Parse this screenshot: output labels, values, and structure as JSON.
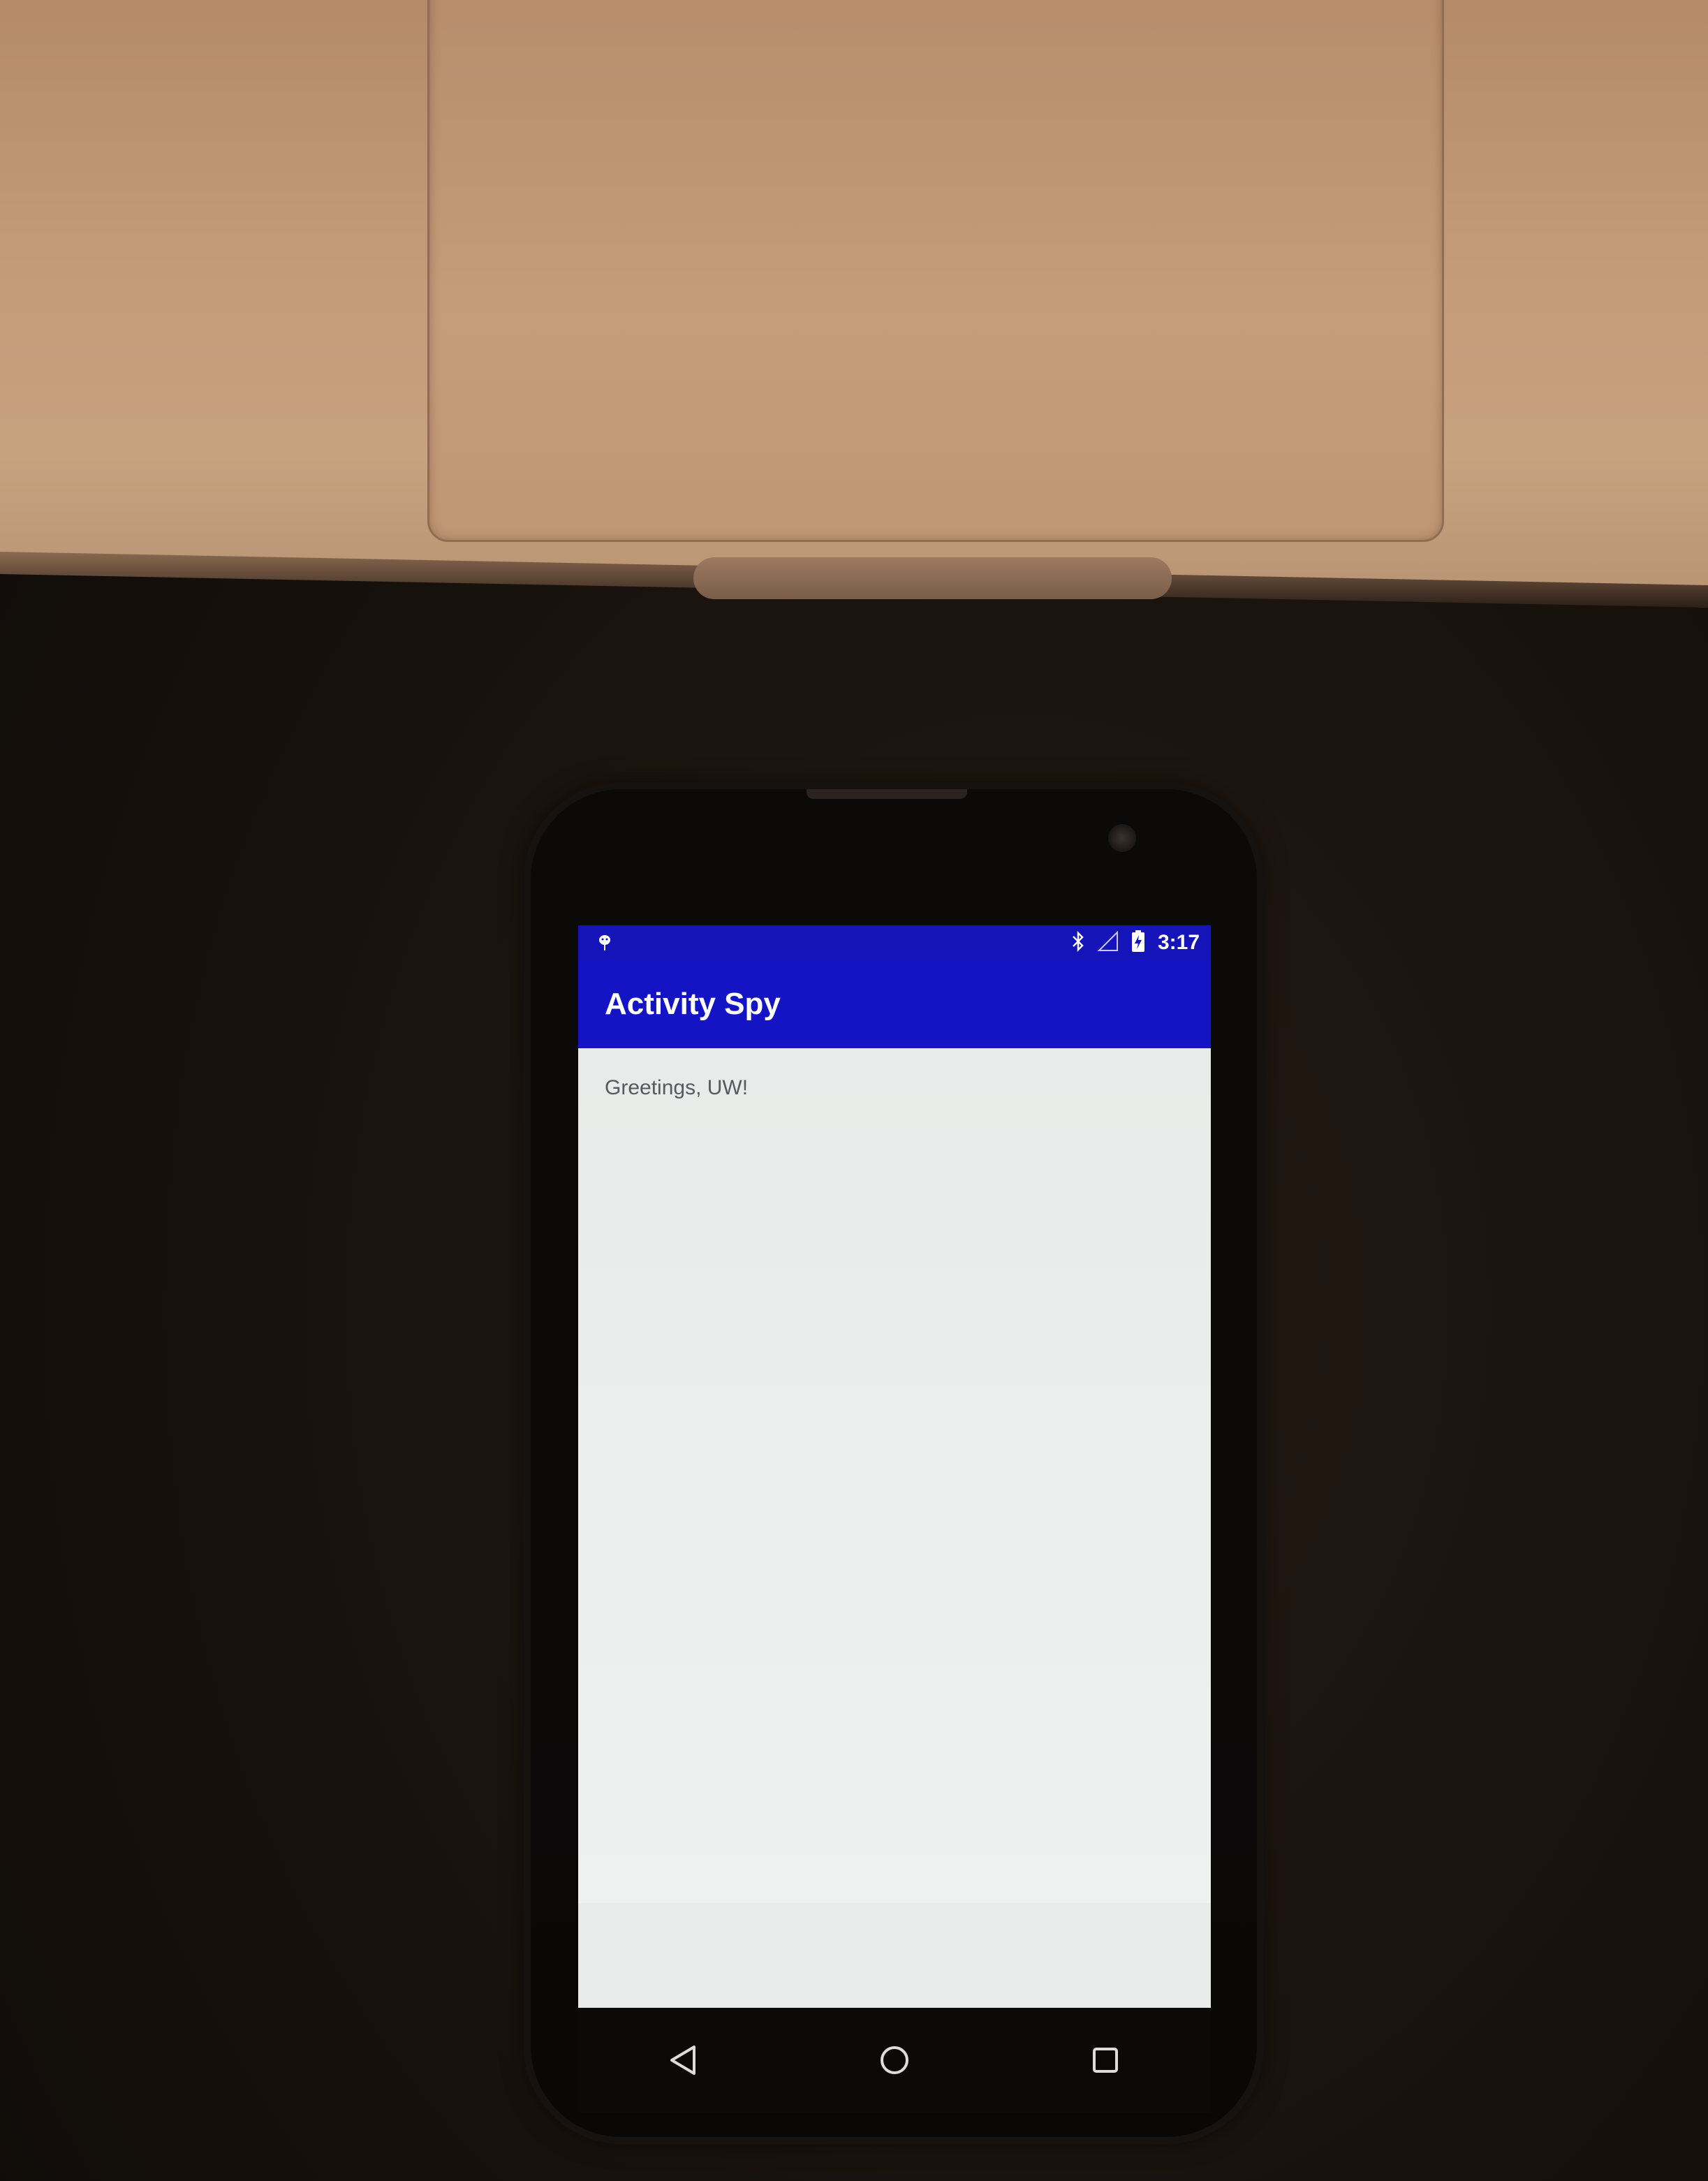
{
  "status_bar": {
    "notification_icon": "android-debug-icon",
    "bluetooth_icon": "bluetooth-icon",
    "signal_icon": "signal-icon",
    "battery_icon": "battery-charging-icon",
    "time": "3:17"
  },
  "app_bar": {
    "title": "Activity Spy",
    "color": "#1414c4"
  },
  "main": {
    "greeting_text": "Greetings, UW!"
  },
  "nav_bar": {
    "back_icon": "back-triangle-icon",
    "home_icon": "home-circle-icon",
    "recents_icon": "recents-square-icon"
  }
}
